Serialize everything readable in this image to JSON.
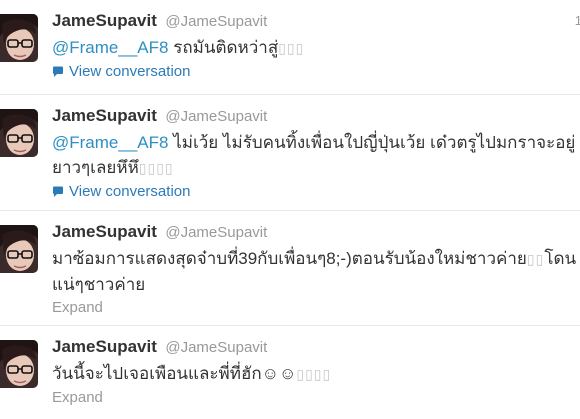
{
  "colors": {
    "mention": "#2d8fc4",
    "link": "#2b7bb9",
    "muted": "#999999",
    "text": "#333333"
  },
  "tweets": [
    {
      "fullname": "JameSupavit",
      "username": "@JameSupavit",
      "time": "1",
      "mention": "@Frame__AF8",
      "text": " รถมันติดหว่าสู่",
      "boxes": "▯▯▯",
      "footer": "View conversation",
      "footer_icon": "speech-bubble-icon"
    },
    {
      "fullname": "JameSupavit",
      "username": "@JameSupavit",
      "mention": "@Frame__AF8",
      "text": " ไม่เว้ย ไม่รับคนทิ้งเพื่อนใปญี่ปุ่นเว้ย เด๋วตรูไปมกราจะอยู่ยาวๆเลยหึหึ",
      "boxes": "▯▯▯▯",
      "footer": "View conversation",
      "footer_icon": "speech-bubble-icon"
    },
    {
      "fullname": "JameSupavit",
      "username": "@JameSupavit",
      "text_a": "มาซ้อมการแสดงสุดจ๋าบที่39กับเพื่อนๆ8;-)ตอนรับน้องใหม่ชาวค่าย",
      "boxes": "▯▯",
      "text_b": "โดนแน่ๆชาวค่าย",
      "footer": "Expand"
    },
    {
      "fullname": "JameSupavit",
      "username": "@JameSupavit",
      "text": "วันนี้จะไปเจอเพือนและพี่ที่ฮัก☺☺",
      "boxes": "▯▯▯▯",
      "footer": "Expand"
    }
  ]
}
